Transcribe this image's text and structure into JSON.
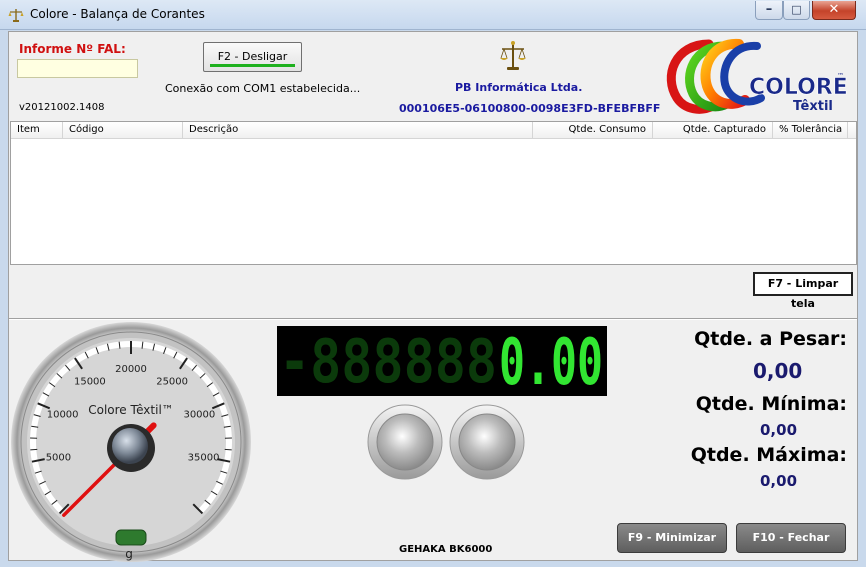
{
  "window": {
    "title": "Colore - Balança de Corantes"
  },
  "header": {
    "fal_label": "Informe Nº FAL:",
    "fal_value": "",
    "version": "v20121002.1408",
    "disconnect_button": "F2 - Desligar",
    "connection_status": "Conexão com COM1 estabelecida...",
    "company": "PB Informática Ltda.",
    "serial": "000106E5-06100800-0098E3FD-BFEBFBFF",
    "logo_word": "COLORE",
    "logo_sub": "Têxtil",
    "logo_tm": "™"
  },
  "grid": {
    "columns": [
      "Item",
      "Código",
      "Descrição",
      "Qtde. Consumo",
      "Qtde. Capturado",
      "% Tolerância"
    ],
    "rows": []
  },
  "clear_button": "F7 - Limpar tela",
  "gauge": {
    "brand": "Colore Têxtil™",
    "unit": "g",
    "ticks": [
      "5000",
      "10000",
      "15000",
      "20000",
      "25000",
      "30000",
      "35000"
    ],
    "value": 0,
    "min": 0,
    "max": 40000
  },
  "display": {
    "dim_text": "-888888",
    "value": "0.00"
  },
  "quantities": {
    "pesar_label": "Qtde. a Pesar:",
    "pesar_value": "0,00",
    "minima_label": "Qtde. Mínima:",
    "minima_value": "0,00",
    "maxima_label": "Qtde. Máxima:",
    "maxima_value": "0,00"
  },
  "model": "GEHAKA BK6000",
  "buttons": {
    "minimize": "F9 - Minimizar",
    "close": "F10 - Fechar"
  },
  "colors": {
    "accent_red": "#d01010",
    "company_blue": "#1a1aa0",
    "digit_green": "#32e632"
  }
}
